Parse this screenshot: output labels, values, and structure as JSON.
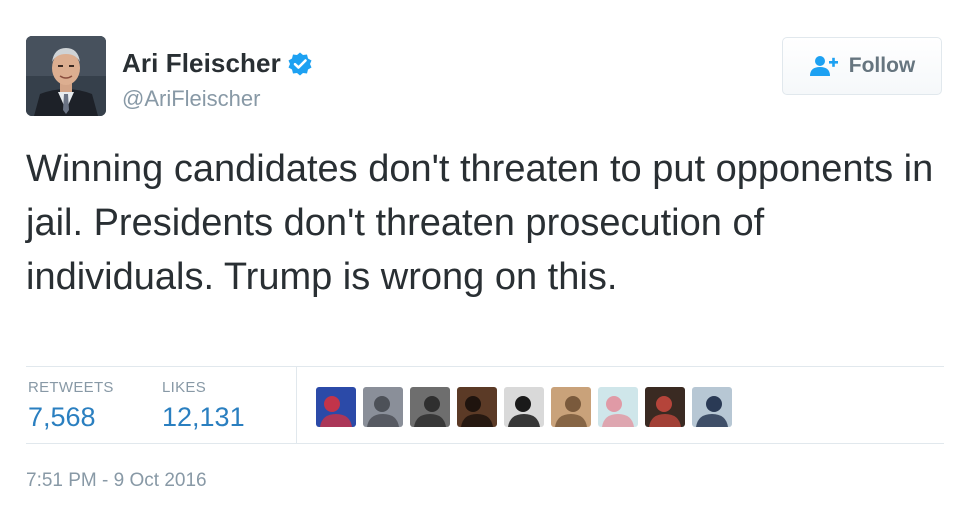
{
  "author": {
    "display_name": "Ari Fleischer",
    "handle": "@AriFleischer",
    "verified": true,
    "avatar_icon": "profile-photo-icon",
    "verified_icon": "verified-badge-icon"
  },
  "follow_button": {
    "label": "Follow",
    "icon": "add-user-icon"
  },
  "tweet": {
    "text": "Winning candidates don't threaten to put opponents in jail. Presidents don't threaten prosecution of individuals. Trump is wrong on this."
  },
  "stats": {
    "retweets_label": "RETWEETS",
    "retweets_value": "7,568",
    "likes_label": "LIKES",
    "likes_value": "12,131"
  },
  "liker_avatars": [
    {
      "icon": "liker-avatar-icon",
      "colors": [
        "#2b4aa8",
        "#c2344a"
      ]
    },
    {
      "icon": "liker-avatar-icon",
      "colors": [
        "#8a8f99",
        "#4d5158"
      ]
    },
    {
      "icon": "liker-avatar-icon",
      "colors": [
        "#6e6e6e",
        "#2f2f2f"
      ]
    },
    {
      "icon": "liker-avatar-icon",
      "colors": [
        "#5b3a26",
        "#1f140e"
      ]
    },
    {
      "icon": "liker-avatar-icon",
      "colors": [
        "#d9d9d9",
        "#1a1a1a"
      ]
    },
    {
      "icon": "liker-avatar-icon",
      "colors": [
        "#c9a27a",
        "#7a5a3c"
      ]
    },
    {
      "icon": "liker-avatar-icon",
      "colors": [
        "#cfe6ea",
        "#e09aa6"
      ]
    },
    {
      "icon": "liker-avatar-icon",
      "colors": [
        "#3a2a22",
        "#b5443a"
      ]
    },
    {
      "icon": "liker-avatar-icon",
      "colors": [
        "#b7c7d4",
        "#2a3a55"
      ]
    }
  ],
  "timestamp": "7:51 PM - 9 Oct 2016",
  "colors": {
    "link_blue": "#2a7fc0",
    "verified_blue": "#1da1f2",
    "muted_gray": "#8899a6",
    "text_dark": "#292f33",
    "border": "#e1e8ed"
  }
}
